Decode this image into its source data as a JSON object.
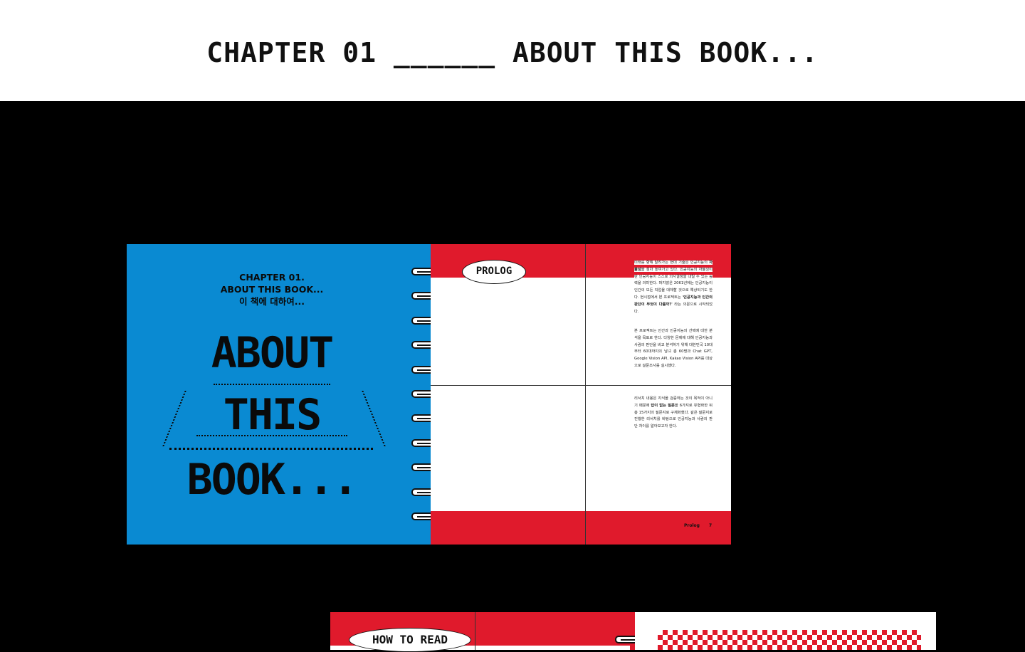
{
  "header": {
    "title": "CHAPTER 01 ______ ABOUT THIS BOOK..."
  },
  "spread1": {
    "left_page": {
      "heading_line1": "CHAPTER 01.",
      "heading_line2": "ABOUT THIS BOOK...",
      "heading_line3": "이 책에 대하여...",
      "big_word1": "ABOUT",
      "big_word2": "THIS",
      "big_word3": "BOOK..."
    },
    "right_page": {
      "tab_label": "PROLOG",
      "para1_a": "미래를 향해 달려가는 현대 기술은 인공지능의 ",
      "para1_b": "자율성",
      "para1_c": "을 점차 높여가고 있다. 인공지능의 자율성이란 인공지능이 스스로 의사결정을 내릴 수 있는 능력을 의미한다. 머지않은 2061년에는 인공지능이 인간의 모든 직업을 대체할 것으로 예상되기도 한다. 현시점에서 본 프로젝트는 '",
      "para1_d": "인공지능과 인간의 판단이 무엇이 다를까?",
      "para1_e": "' 라는 의문으로 시작되었다.",
      "para2": "본 프로젝트는 인간과 인공지능의 선택에 대한 분석을 목표로 한다. 다양한 문제에 대해 인공지능과 사람의 판단을 비교 분석하기 위해 대한민국 10대부터 60대까지의 남녀 총 60명과 Chat GPT, Google Vision API, Kakao Vision API를 대상으로 설문조사를 실시했다.",
      "para3_a": "리서치 내용은 지식을 검증하는 것이 목적이 아니기 때문에 ",
      "para3_b": "답이 없는 질문",
      "para3_c": "을 6가지로 유형화한 뒤 총 15가지의 질문지로 구체화했다. 같은 질문지로 진행한 리서치를 바탕으로 인공지능과 사람의 판단 차이를 알아보고자 한다.",
      "footer_label": "Prolog",
      "page_number": "7"
    }
  },
  "spread2": {
    "tab_label": "HOW TO READ"
  },
  "colors": {
    "blue": "#0a8ad2",
    "red": "#e01a2c",
    "black": "#000000",
    "white": "#ffffff"
  }
}
